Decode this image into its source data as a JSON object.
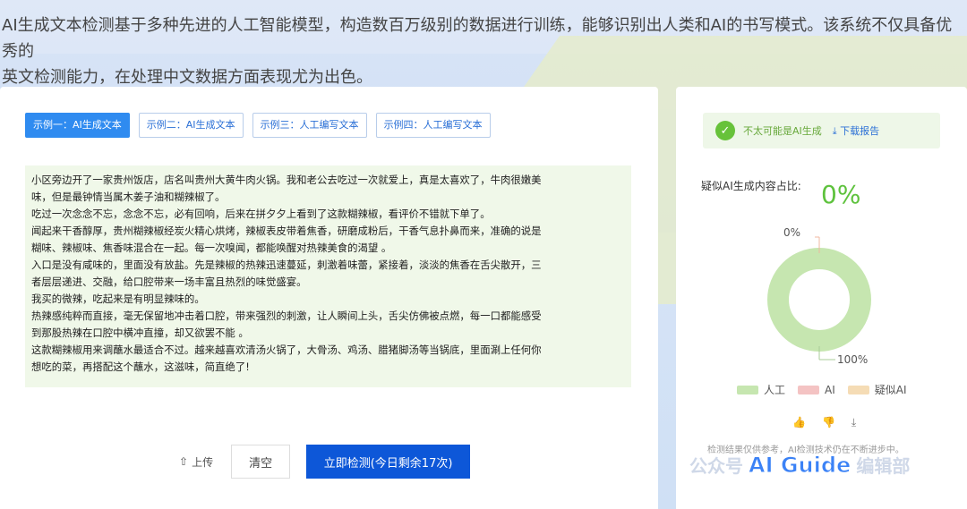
{
  "intro": {
    "line1": "AI生成文本检测基于多种先进的人工智能模型，构造数百万级别的数据进行训练，能够识别出人类和AI的书写模式。该系统不仅具备优秀的",
    "line2": "英文检测能力，在处理中文数据方面表现尤为出色。"
  },
  "tabs": [
    {
      "label": "示例一：AI生成文本",
      "active": true
    },
    {
      "label": "示例二：AI生成文本",
      "active": false
    },
    {
      "label": "示例三：人工编写文本",
      "active": false
    },
    {
      "label": "示例四：人工编写文本",
      "active": false
    }
  ],
  "text_lines": [
    "小区旁边开了一家贵州饭店，店名叫贵州大黄牛肉火锅。我和老公去吃过一次就爱上，真是太喜欢了，牛肉很嫩美",
    "味，但是最钟情当属木姜子油和糊辣椒了。",
    "吃过一次念念不忘，念念不忘，必有回响，后来在拼夕夕上看到了这款糊辣椒，看评价不错就下单了。",
    "闻起来干香醇厚，贵州糊辣椒经炭火精心烘烤，辣椒表皮带着焦香，研磨成粉后，干香气息扑鼻而来，准确的说是",
    "糊味、辣椒味、焦香味混合在一起。每一次嗅闻，都能唤醒对热辣美食的渴望 。",
    "入口是没有咸味的，里面没有放盐。先是辣椒的热辣迅速蔓延，刺激着味蕾，紧接着，淡淡的焦香在舌尖散开，三",
    "者层层递进、交融，给口腔带来一场丰富且热烈的味觉盛宴。",
    "我买的微辣，吃起来是有明显辣味的。",
    "热辣感纯粹而直接，毫无保留地冲击着口腔，带来强烈的刺激，让人瞬间上头，舌尖仿佛被点燃，每一口都能感受",
    "到那股热辣在口腔中横冲直撞，却又欲罢不能 。",
    "这款糊辣椒用来调蘸水最适合不过。越来越喜欢清汤火锅了，大骨汤、鸡汤、腊猪脚汤等当锅底，里面涮上任何你",
    "想吃的菜，再搭配这个蘸水，这滋味，简直绝了!"
  ],
  "actions": {
    "upload_label": "上传",
    "clear_label": "清空",
    "detect_label": "立即检测(今日剩余17次)"
  },
  "result": {
    "verdict": "不太可能是AI生成",
    "download": "下载报告",
    "ratio_label": "疑似AI生成内容占比:",
    "ratio_value": "0%"
  },
  "donut": {
    "top_label": "0%",
    "bottom_label": "100%",
    "human_fraction": 1.0,
    "ai_fraction": 0.0,
    "suspect_fraction": 0.0
  },
  "legend": [
    {
      "label": "人工",
      "color": "#c6e6b0"
    },
    {
      "label": "AI",
      "color": "#f4c3c3"
    },
    {
      "label": "疑似AI",
      "color": "#f5dcb5"
    }
  ],
  "disclaimer": "检测结果仅供参考，AI检测技术仍在不断进步中。",
  "watermark": {
    "left": "公众号",
    "guide": "AI Guide",
    "right": "编辑部"
  }
}
